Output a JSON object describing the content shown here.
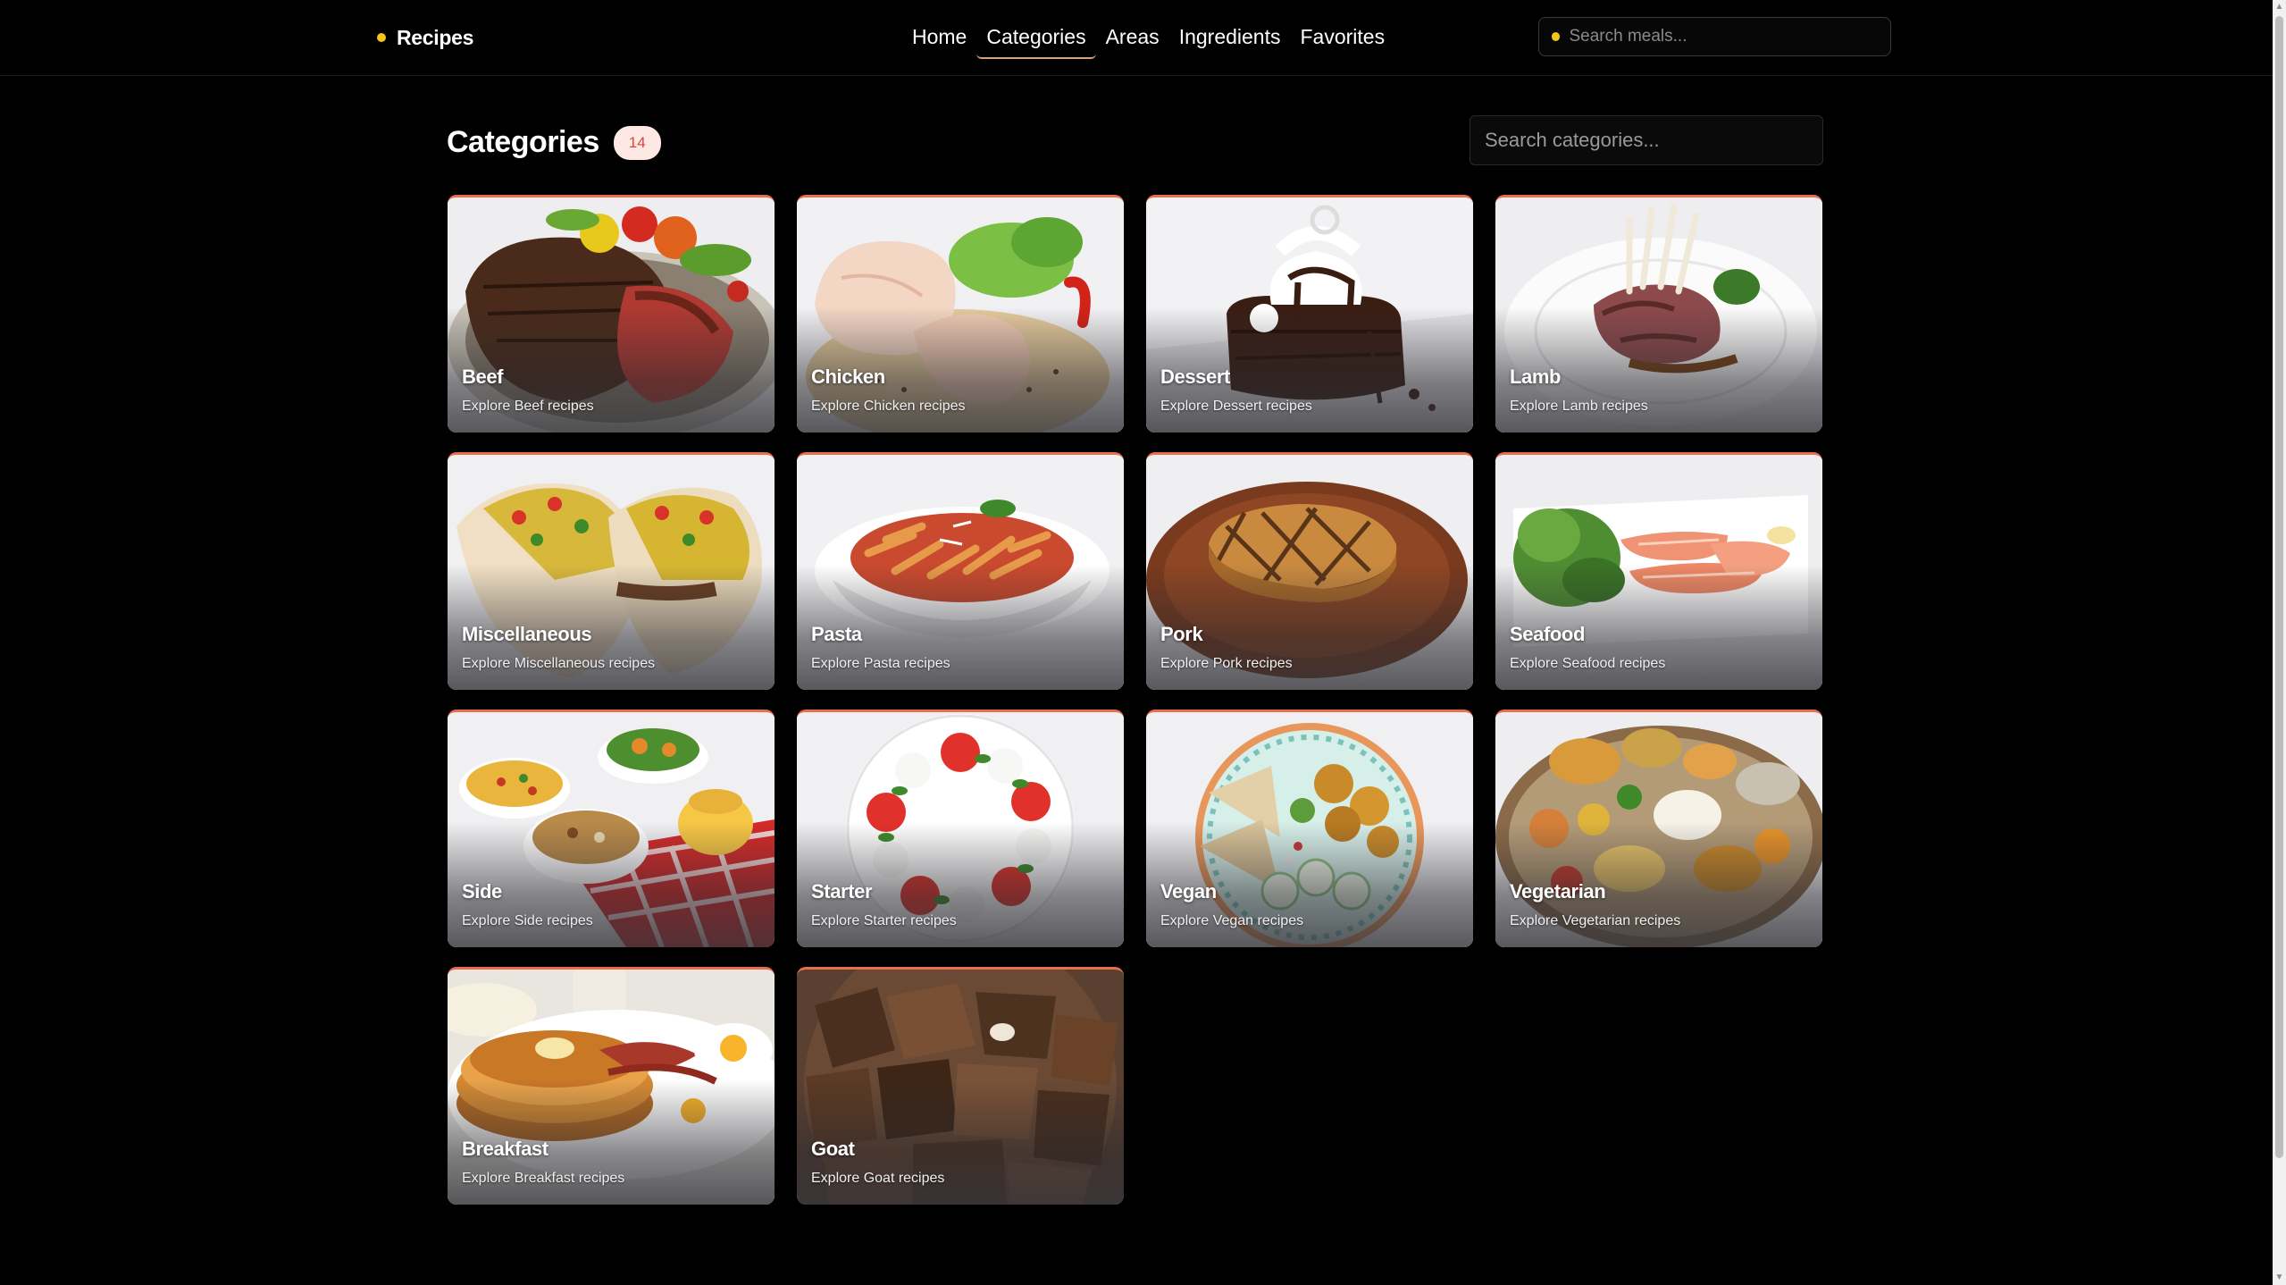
{
  "header": {
    "brand": "Recipes",
    "nav": [
      "Home",
      "Categories",
      "Areas",
      "Ingredients",
      "Favorites"
    ],
    "active_nav": "Categories",
    "search_placeholder": "Search meals..."
  },
  "page": {
    "title": "Categories",
    "count": "14",
    "search_placeholder": "Search categories..."
  },
  "categories": [
    {
      "name": "Beef",
      "description": "Explore Beef recipes",
      "image": "steak"
    },
    {
      "name": "Chicken",
      "description": "Explore Chicken recipes",
      "image": "chicken"
    },
    {
      "name": "Dessert",
      "description": "Explore Dessert recipes",
      "image": "dessert"
    },
    {
      "name": "Lamb",
      "description": "Explore Lamb recipes",
      "image": "lamb"
    },
    {
      "name": "Miscellaneous",
      "description": "Explore Miscellaneous recipes",
      "image": "tacos"
    },
    {
      "name": "Pasta",
      "description": "Explore Pasta recipes",
      "image": "pasta"
    },
    {
      "name": "Pork",
      "description": "Explore Pork recipes",
      "image": "pork"
    },
    {
      "name": "Seafood",
      "description": "Explore Seafood recipes",
      "image": "seafood"
    },
    {
      "name": "Side",
      "description": "Explore Side recipes",
      "image": "sides"
    },
    {
      "name": "Starter",
      "description": "Explore Starter recipes",
      "image": "caprese"
    },
    {
      "name": "Vegan",
      "description": "Explore Vegan recipes",
      "image": "vegan-bowl"
    },
    {
      "name": "Vegetarian",
      "description": "Explore Vegetarian recipes",
      "image": "thali"
    },
    {
      "name": "Breakfast",
      "description": "Explore Breakfast recipes",
      "image": "pancakes"
    },
    {
      "name": "Goat",
      "description": "Explore Goat recipes",
      "image": "goat-stew"
    }
  ],
  "colors": {
    "background": "#000000",
    "accent": "#e96d4f",
    "brand_dot": "#f5c518",
    "badge_bg": "#fde8e3",
    "badge_text": "#d9473a"
  }
}
